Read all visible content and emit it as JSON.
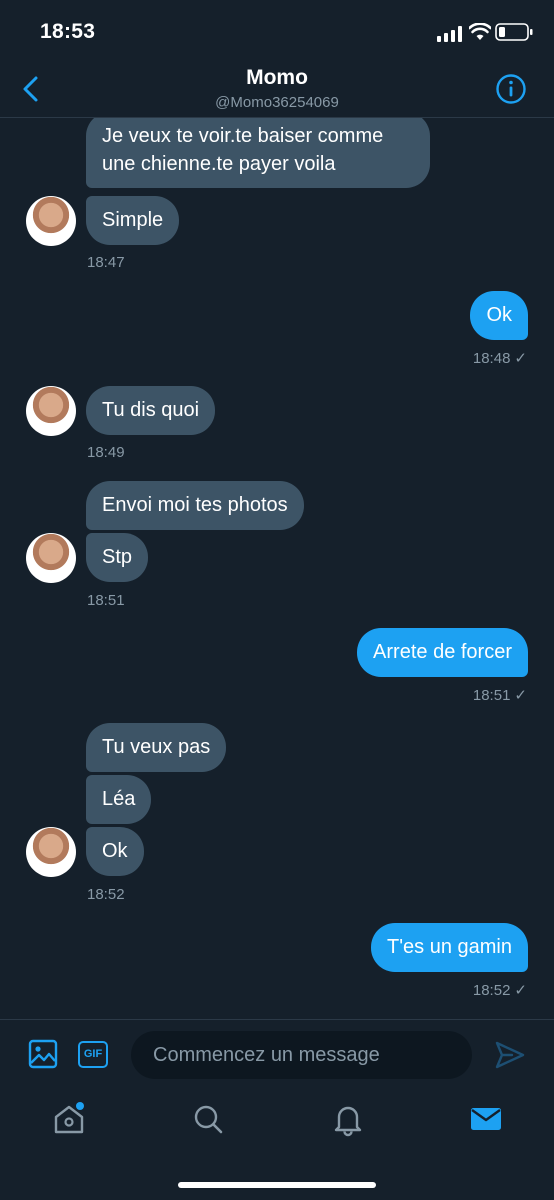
{
  "status_bar": {
    "time": "18:53"
  },
  "header": {
    "name": "Momo",
    "handle": "@Momo36254069"
  },
  "messages": {
    "m1": "Je veux te voir.te baiser comme une chienne.te payer voila",
    "m2": "Simple",
    "t1": "18:47",
    "m3": "Ok",
    "t2": "18:48",
    "m4": "Tu dis quoi",
    "t3": "18:49",
    "m5": "Envoi moi tes photos",
    "m6": "Stp",
    "t4": "18:51",
    "m7": "Arrete de forcer",
    "t5": "18:51",
    "m8": "Tu veux pas",
    "m9": "Léa",
    "m10": "Ok",
    "t6": "18:52",
    "m11": "T'es un gamin",
    "t7": "18:52",
    "read_mark": "✓"
  },
  "composer": {
    "placeholder": "Commencez un message",
    "gif_label": "GIF"
  },
  "colors": {
    "background": "#15202b",
    "accent": "#1da1f2",
    "received_bubble": "#3d5466",
    "muted_text": "#8899a6"
  },
  "icons": [
    "back-arrow-icon",
    "info-icon",
    "image-icon",
    "gif-icon",
    "send-icon",
    "home-icon",
    "search-icon",
    "bell-icon",
    "mail-icon"
  ]
}
